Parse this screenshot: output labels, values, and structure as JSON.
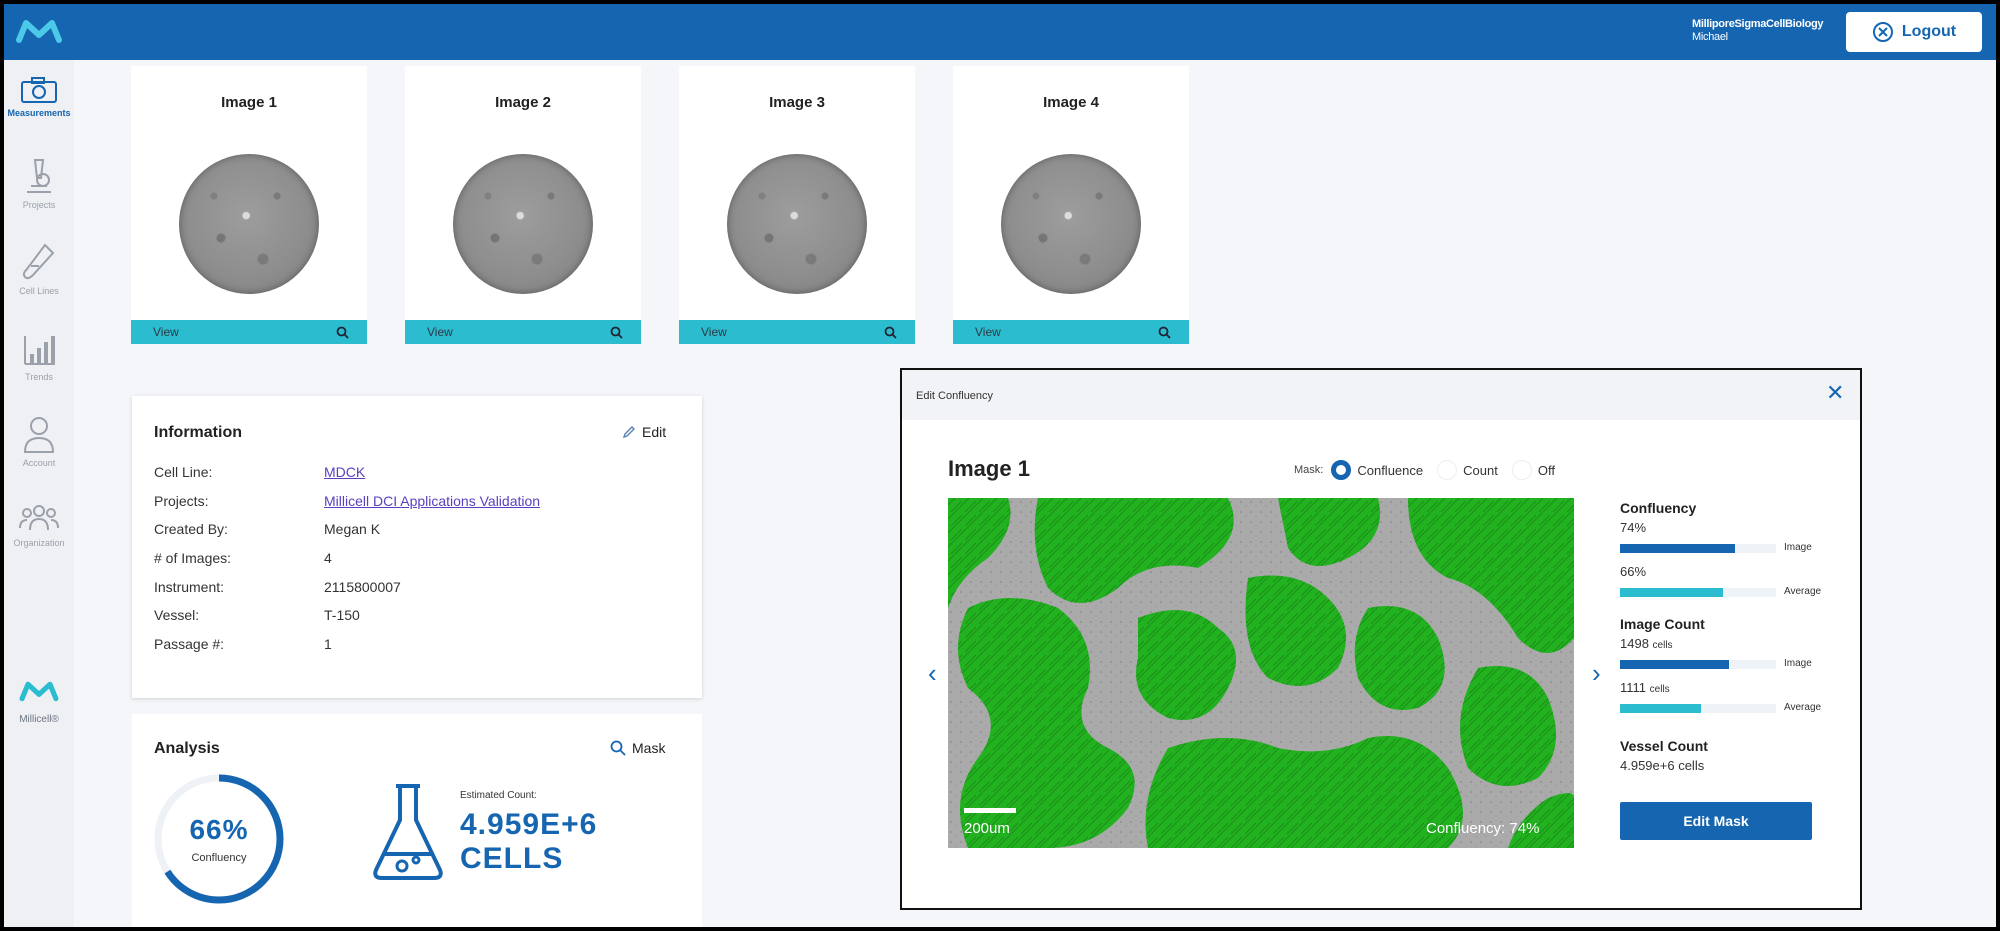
{
  "header": {
    "org_name": "MilliporeSigmaCellBiology",
    "user_name": "Michael",
    "logout_label": "Logout"
  },
  "sidebar": {
    "items": [
      {
        "label": "Measurements",
        "icon": "camera-icon",
        "active": true
      },
      {
        "label": "Projects",
        "icon": "microscope-icon"
      },
      {
        "label": "Cell Lines",
        "icon": "test-tube-icon"
      },
      {
        "label": "Trends",
        "icon": "bar-chart-icon"
      },
      {
        "label": "Account",
        "icon": "person-icon"
      },
      {
        "label": "Organization",
        "icon": "group-icon"
      }
    ],
    "brand_label": "Millicell®"
  },
  "images": [
    {
      "title": "Image 1",
      "view_label": "View"
    },
    {
      "title": "Image 2",
      "view_label": "View"
    },
    {
      "title": "Image 3",
      "view_label": "View"
    },
    {
      "title": "Image 4",
      "view_label": "View"
    }
  ],
  "information": {
    "title": "Information",
    "edit_label": "Edit",
    "rows": [
      {
        "label": "Cell Line:",
        "value": "MDCK"
      },
      {
        "label": "Projects:",
        "value": "Millicell DCI Applications Validation"
      },
      {
        "label": "Created By:",
        "value": "Megan K"
      },
      {
        "label": "# of Images:",
        "value": "4"
      },
      {
        "label": "Instrument:",
        "value": "2115800007"
      },
      {
        "label": "Vessel:",
        "value": "T-150"
      },
      {
        "label": "Passage #:",
        "value": "1"
      }
    ]
  },
  "analysis": {
    "title": "Analysis",
    "mask_label": "Mask",
    "confluency_value": "66%",
    "confluency_fraction": 0.66,
    "confluency_label": "Confluency",
    "estimated_label": "Estimated Count:",
    "estimated_value": "4.959E+6",
    "estimated_unit": "CELLS"
  },
  "modal": {
    "title": "Edit Confluency",
    "image_title": "Image 1",
    "mask_label": "Mask:",
    "mask_options": [
      "Confluence",
      "Count",
      "Off"
    ],
    "mask_selected": "Confluence",
    "scale_label": "200um",
    "overlay_label": "Confluency:",
    "overlay_value": "74%",
    "stats": {
      "confluency": {
        "heading": "Confluency",
        "image_value": "74%",
        "image_fraction": 0.74,
        "image_tag": "Image",
        "average_value": "66%",
        "average_fraction": 0.66,
        "average_tag": "Average"
      },
      "image_count": {
        "heading": "Image Count",
        "image_value": "1498",
        "image_unit": "cells",
        "image_fraction": 0.7,
        "image_tag": "Image",
        "average_value": "1111",
        "average_unit": "cells",
        "average_fraction": 0.52,
        "average_tag": "Average"
      },
      "vessel_count": {
        "heading": "Vessel Count",
        "value": "4.959e+6 cells"
      }
    },
    "edit_mask_label": "Edit Mask"
  },
  "colors": {
    "primary": "#1565b0",
    "teal": "#2bbcd0",
    "mask_green": "#22b11f"
  }
}
